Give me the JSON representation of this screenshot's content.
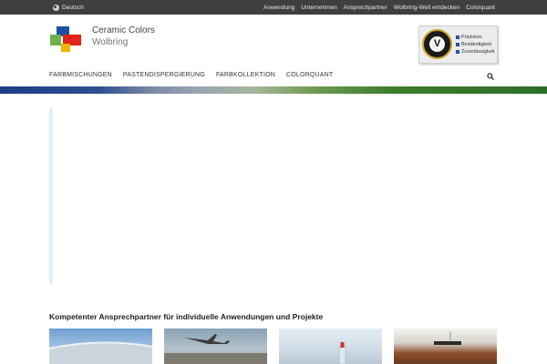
{
  "topbar": {
    "language": "Deutsch",
    "links": [
      "Anwendung",
      "Unternehmen",
      "Ansprechpartner",
      "Wolbring-Welt entdecken",
      "Colorquant"
    ]
  },
  "brand": {
    "line1": "Ceramic Colors",
    "line2": "Wolbring",
    "logo_colors": [
      "#1f4fa3",
      "#6fb24b",
      "#e2231a",
      "#f0b400"
    ]
  },
  "seal": {
    "badge_letter": "V",
    "items": [
      "Präzision",
      "Beständigkeit",
      "Zuverlässigkeit"
    ]
  },
  "nav": {
    "items": [
      "FARBMISCHUNGEN",
      "PASTENDISPERGIERUNG",
      "FARBKOLLEKTION",
      "COLORQUANT"
    ]
  },
  "section": {
    "title": "Kompetenter Ansprechpartner für individuelle Anwendungen und Projekte"
  },
  "colors": {
    "topbar_bg": "#3f3f3f",
    "stripe_start": "#1b3d86",
    "stripe_end": "#2c6e25"
  }
}
